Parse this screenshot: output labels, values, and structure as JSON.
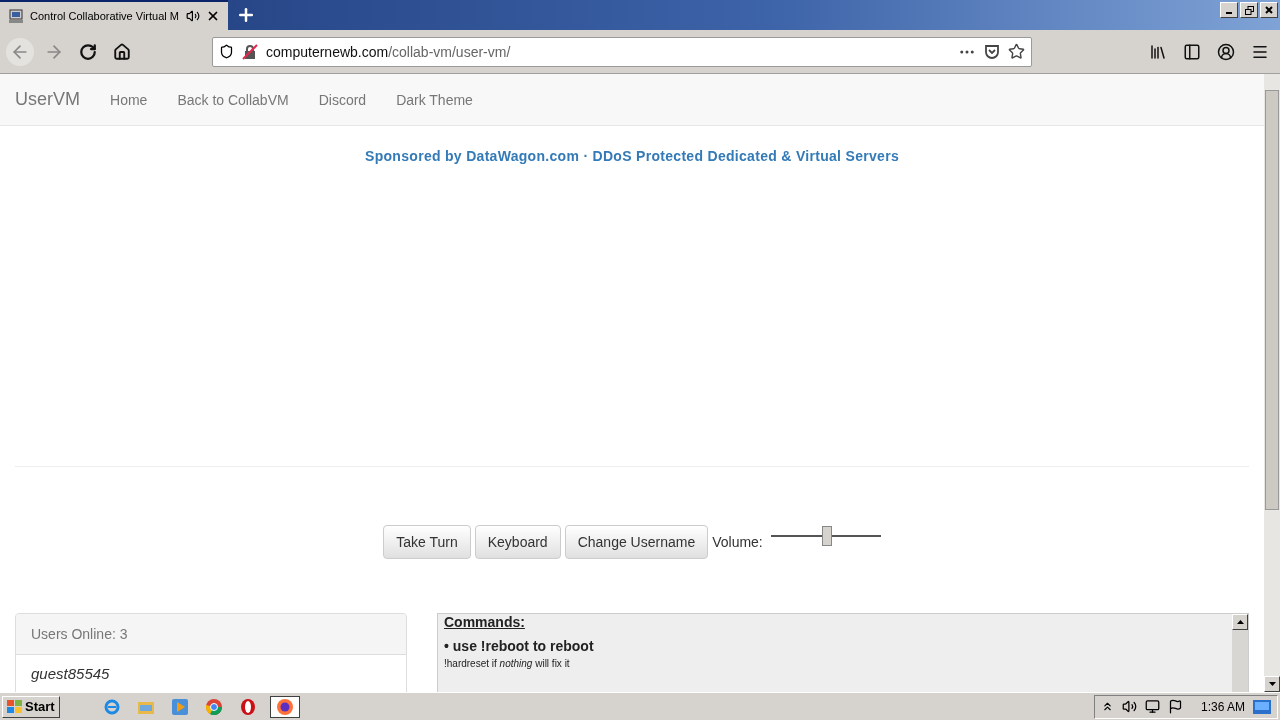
{
  "browser": {
    "tab": {
      "title": "Control Collaborative Virtual M",
      "audio": true
    },
    "url_domain": "computernewb.com",
    "url_path": "/collab-vm/user-vm/"
  },
  "navbar": {
    "brand": "UserVM",
    "links": [
      "Home",
      "Back to CollabVM",
      "Discord",
      "Dark Theme"
    ]
  },
  "sponsor": {
    "text": "Sponsored by DataWagon.com · DDoS Protected Dedicated & Virtual Servers"
  },
  "controls": {
    "buttons": [
      "Take Turn",
      "Keyboard",
      "Change Username"
    ],
    "volume": {
      "label": "Volume:",
      "level": 0.51
    }
  },
  "users": {
    "header": "Users Online: 3",
    "list": [
      "guest85545"
    ]
  },
  "commands": {
    "heading": "Commands:",
    "items": [
      {
        "title": "• use !reboot to reboot",
        "note": "!hardreset if *nothing* will fix it"
      }
    ]
  },
  "taskbar": {
    "start": "Start",
    "apps": [
      {
        "kind": "ie",
        "selected": false
      },
      {
        "kind": "folder",
        "selected": false
      },
      {
        "kind": "media",
        "selected": false
      },
      {
        "kind": "chrome",
        "selected": false
      },
      {
        "kind": "opera",
        "selected": false
      },
      {
        "kind": "firefox",
        "selected": true
      }
    ],
    "clock": "1:36 AM"
  }
}
